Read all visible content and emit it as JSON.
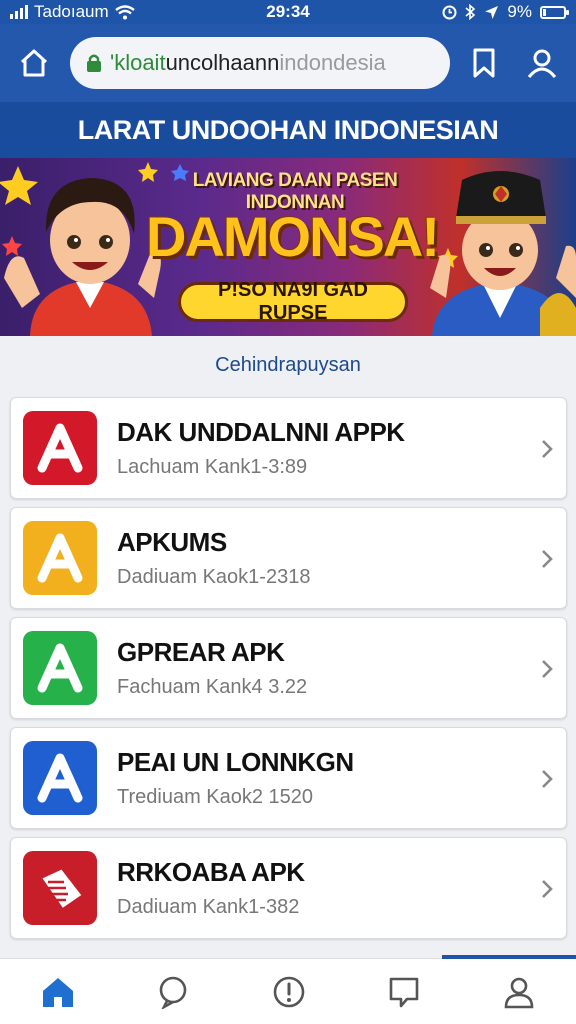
{
  "status_bar": {
    "carrier": "Tadoıaum",
    "time": "29:34",
    "battery": "9%"
  },
  "browser": {
    "url_prefix": "'kloait",
    "url_main": " uncolhaann",
    "url_tail": " indondesia"
  },
  "page_title": "LARAT UNDOOHAN INDONESIAN",
  "banner": {
    "subtitle": "LAVIANG DAAN PASEN INDONNAN",
    "headline": "DAMONSA!",
    "pill": "P!SO NA9I GAD RUPSE"
  },
  "section_label": "Cehindrapuysan",
  "apps": [
    {
      "title": "DAK UNDDALNNI APPK",
      "subtitle": "Lachuam Kank1-3:89",
      "color": "#d3182a",
      "icon": "app-store-icon"
    },
    {
      "title": "APKUMS",
      "subtitle": "Dadiuam Kaok1-2318",
      "color": "#f2b01e",
      "icon": "app-store-icon"
    },
    {
      "title": "GPREAR APK",
      "subtitle": "Fachuam Kank4 3.22",
      "color": "#27b14a",
      "icon": "app-store-icon"
    },
    {
      "title": "PEAI UN LONNKGN",
      "subtitle": "Trediuam Kaok2 1520",
      "color": "#1f5fd0",
      "icon": "app-store-icon"
    },
    {
      "title": "RRKOABA APK",
      "subtitle": "Dadiuam Kank1-382",
      "color": "#c81e2a",
      "icon": "tag-icon"
    }
  ],
  "colors": {
    "brand": "#1f55a8",
    "title_bar": "#1a4c9e"
  }
}
